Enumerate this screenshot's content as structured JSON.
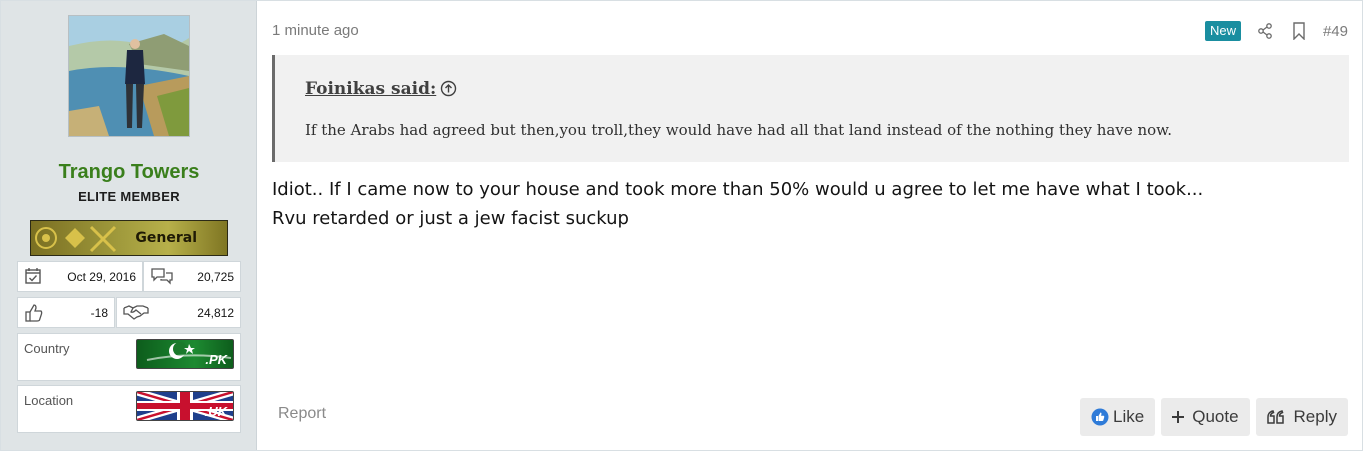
{
  "user": {
    "name": "Trango Towers",
    "title": "ELITE MEMBER",
    "rank": "General",
    "joined": "Oct 29, 2016",
    "messages": "20,725",
    "reaction_score": "-18",
    "points": "24,812",
    "country_label": "Country",
    "country_code": ".PK",
    "location_label": "Location",
    "location_code": ".UK"
  },
  "post": {
    "time": "1 minute ago",
    "badge": "New",
    "number": "#49",
    "quote_author": "Foinikas said:",
    "quote_text": "If the Arabs had agreed but then,you troll,they would have had all that land instead of the nothing they have now.",
    "lines": [
      "Idiot.. If I came now to your house and took more than 50% would u agree to let me have what I took...",
      "Rvu retarded or just a jew facist suckup"
    ]
  },
  "actions": {
    "report": "Report",
    "like": "Like",
    "quote": "Quote",
    "reply": "Reply"
  },
  "icons": {
    "share": "share-icon",
    "bookmark": "bookmark-icon",
    "quote_jump": "arrow-up-circle-icon",
    "calendar": "calendar-check-icon",
    "messages": "speech-bubbles-icon",
    "reaction": "thumbs-up-icon",
    "points": "handshake-icon"
  },
  "colors": {
    "username": "#3a7f1c",
    "badge_new": "#1a8ea0",
    "sidebar_bg": "#dfe4e6",
    "like_icon": "#2f7bd8"
  }
}
